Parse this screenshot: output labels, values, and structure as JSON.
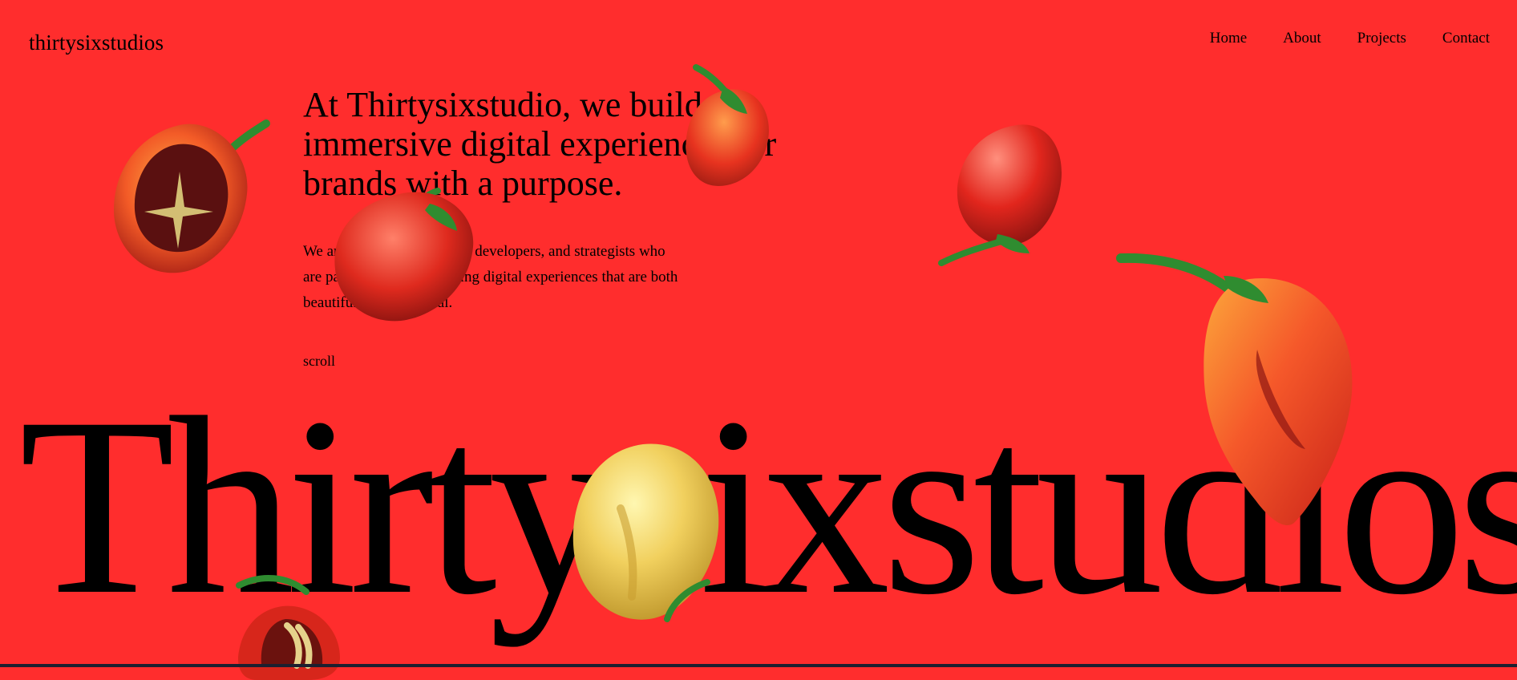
{
  "header": {
    "logo": "thirtysixstudios",
    "nav": [
      "Home",
      "About",
      "Projects",
      "Contact"
    ]
  },
  "hero": {
    "headline": "At Thirtysixstudio, we build immersive digital experiences for brands with a purpose.",
    "lead": "We are a team of designers, developers, and strategists who are passionate about creating digital experiences that are both beautiful and functional.",
    "scroll_label": "scroll",
    "wordmark": "Thirtysixstudios"
  },
  "colors": {
    "background": "#ff2d2d",
    "text": "#000000",
    "pepper_red": "#e52f22",
    "pepper_orange": "#f56b25",
    "pepper_yellow": "#f2cc4e",
    "stem_green": "#2f8c30"
  },
  "decorations": {
    "icons": [
      "cut-pepper-icon",
      "red-pepper-icon",
      "small-red-pepper-icon",
      "red-pepper-icon",
      "orange-pepper-icon",
      "yellow-pepper-icon",
      "cut-yellow-pepper-icon"
    ]
  }
}
